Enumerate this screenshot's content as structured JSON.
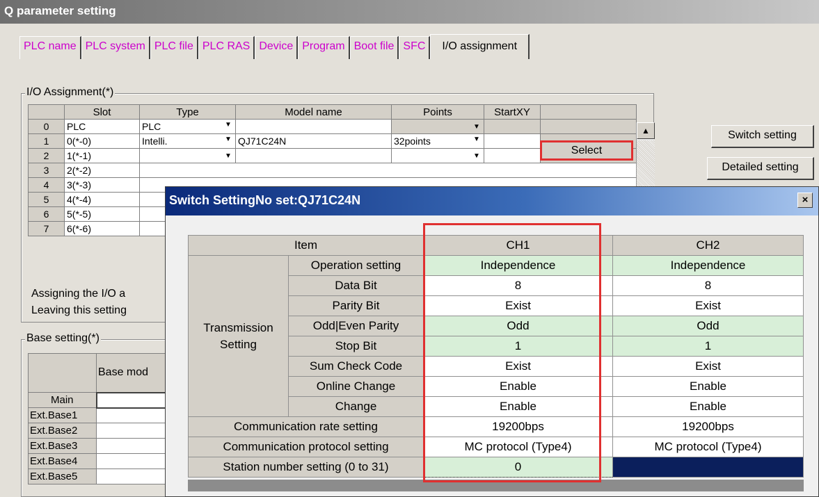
{
  "window": {
    "title": "Q parameter setting"
  },
  "tabs": [
    {
      "label": "PLC name"
    },
    {
      "label": "PLC system"
    },
    {
      "label": "PLC file"
    },
    {
      "label": "PLC RAS"
    },
    {
      "label": "Device"
    },
    {
      "label": "Program"
    },
    {
      "label": "Boot file"
    },
    {
      "label": "SFC"
    },
    {
      "label": "I/O assignment"
    }
  ],
  "io": {
    "group_label": "I/O Assignment(*)",
    "headers": {
      "slot": "Slot",
      "type": "Type",
      "model": "Model name",
      "points": "Points",
      "startxy": "StartXY"
    },
    "rows": [
      {
        "num": "0",
        "slot": "PLC",
        "type": "PLC",
        "model": "",
        "points": ""
      },
      {
        "num": "1",
        "slot": "0(*-0)",
        "type": "Intelli.",
        "model": "QJ71C24N",
        "points": "32points"
      },
      {
        "num": "2",
        "slot": "1(*-1)",
        "type": "",
        "model": "",
        "points": ""
      },
      {
        "num": "3",
        "slot": "2(*-2)"
      },
      {
        "num": "4",
        "slot": "3(*-3)"
      },
      {
        "num": "5",
        "slot": "4(*-4)"
      },
      {
        "num": "6",
        "slot": "5(*-5)"
      },
      {
        "num": "7",
        "slot": "6(*-6)"
      }
    ],
    "select_label": "Select",
    "note_line1": "Assigning the I/O a",
    "note_line2": "Leaving this setting"
  },
  "buttons": {
    "switch_setting": "Switch setting",
    "detailed_setting": "Detailed setting"
  },
  "base": {
    "group_label": "Base setting(*)",
    "header": "Base mod",
    "rows": [
      "Main",
      "Ext.Base1",
      "Ext.Base2",
      "Ext.Base3",
      "Ext.Base4",
      "Ext.Base5"
    ]
  },
  "dialog": {
    "title": "Switch SettingNo set:QJ71C24N",
    "close": "×",
    "headers": {
      "item": "Item",
      "ch1": "CH1",
      "ch2": "CH2"
    },
    "group_label_1": "Transmission",
    "group_label_2": "Setting",
    "transmission_rows": [
      {
        "item": "Operation setting",
        "ch1": "Independence",
        "ch2": "Independence"
      },
      {
        "item": "Data Bit",
        "ch1": "8",
        "ch2": "8"
      },
      {
        "item": "Parity Bit",
        "ch1": "Exist",
        "ch2": "Exist"
      },
      {
        "item": "Odd|Even Parity",
        "ch1": "Odd",
        "ch2": "Odd"
      },
      {
        "item": "Stop Bit",
        "ch1": "1",
        "ch2": "1"
      },
      {
        "item": "Sum Check Code",
        "ch1": "Exist",
        "ch2": "Exist"
      },
      {
        "item": "Online Change",
        "ch1": "Enable",
        "ch2": "Enable"
      },
      {
        "item": "Change",
        "ch1": "Enable",
        "ch2": "Enable"
      }
    ],
    "other_rows": [
      {
        "item": "Communication rate setting",
        "ch1": "19200bps",
        "ch2": "19200bps"
      },
      {
        "item": "Communication protocol setting",
        "ch1": "MC protocol (Type4)",
        "ch2": "MC protocol (Type4)"
      },
      {
        "item": "Station number setting (0 to 31)",
        "ch1": "0",
        "ch2": ""
      }
    ]
  },
  "colors": {
    "highlight_red": "#e03030",
    "green_row": "#d8efd8",
    "selected_cell": "#0b1f5c",
    "tab_text": "#cc00cc"
  }
}
